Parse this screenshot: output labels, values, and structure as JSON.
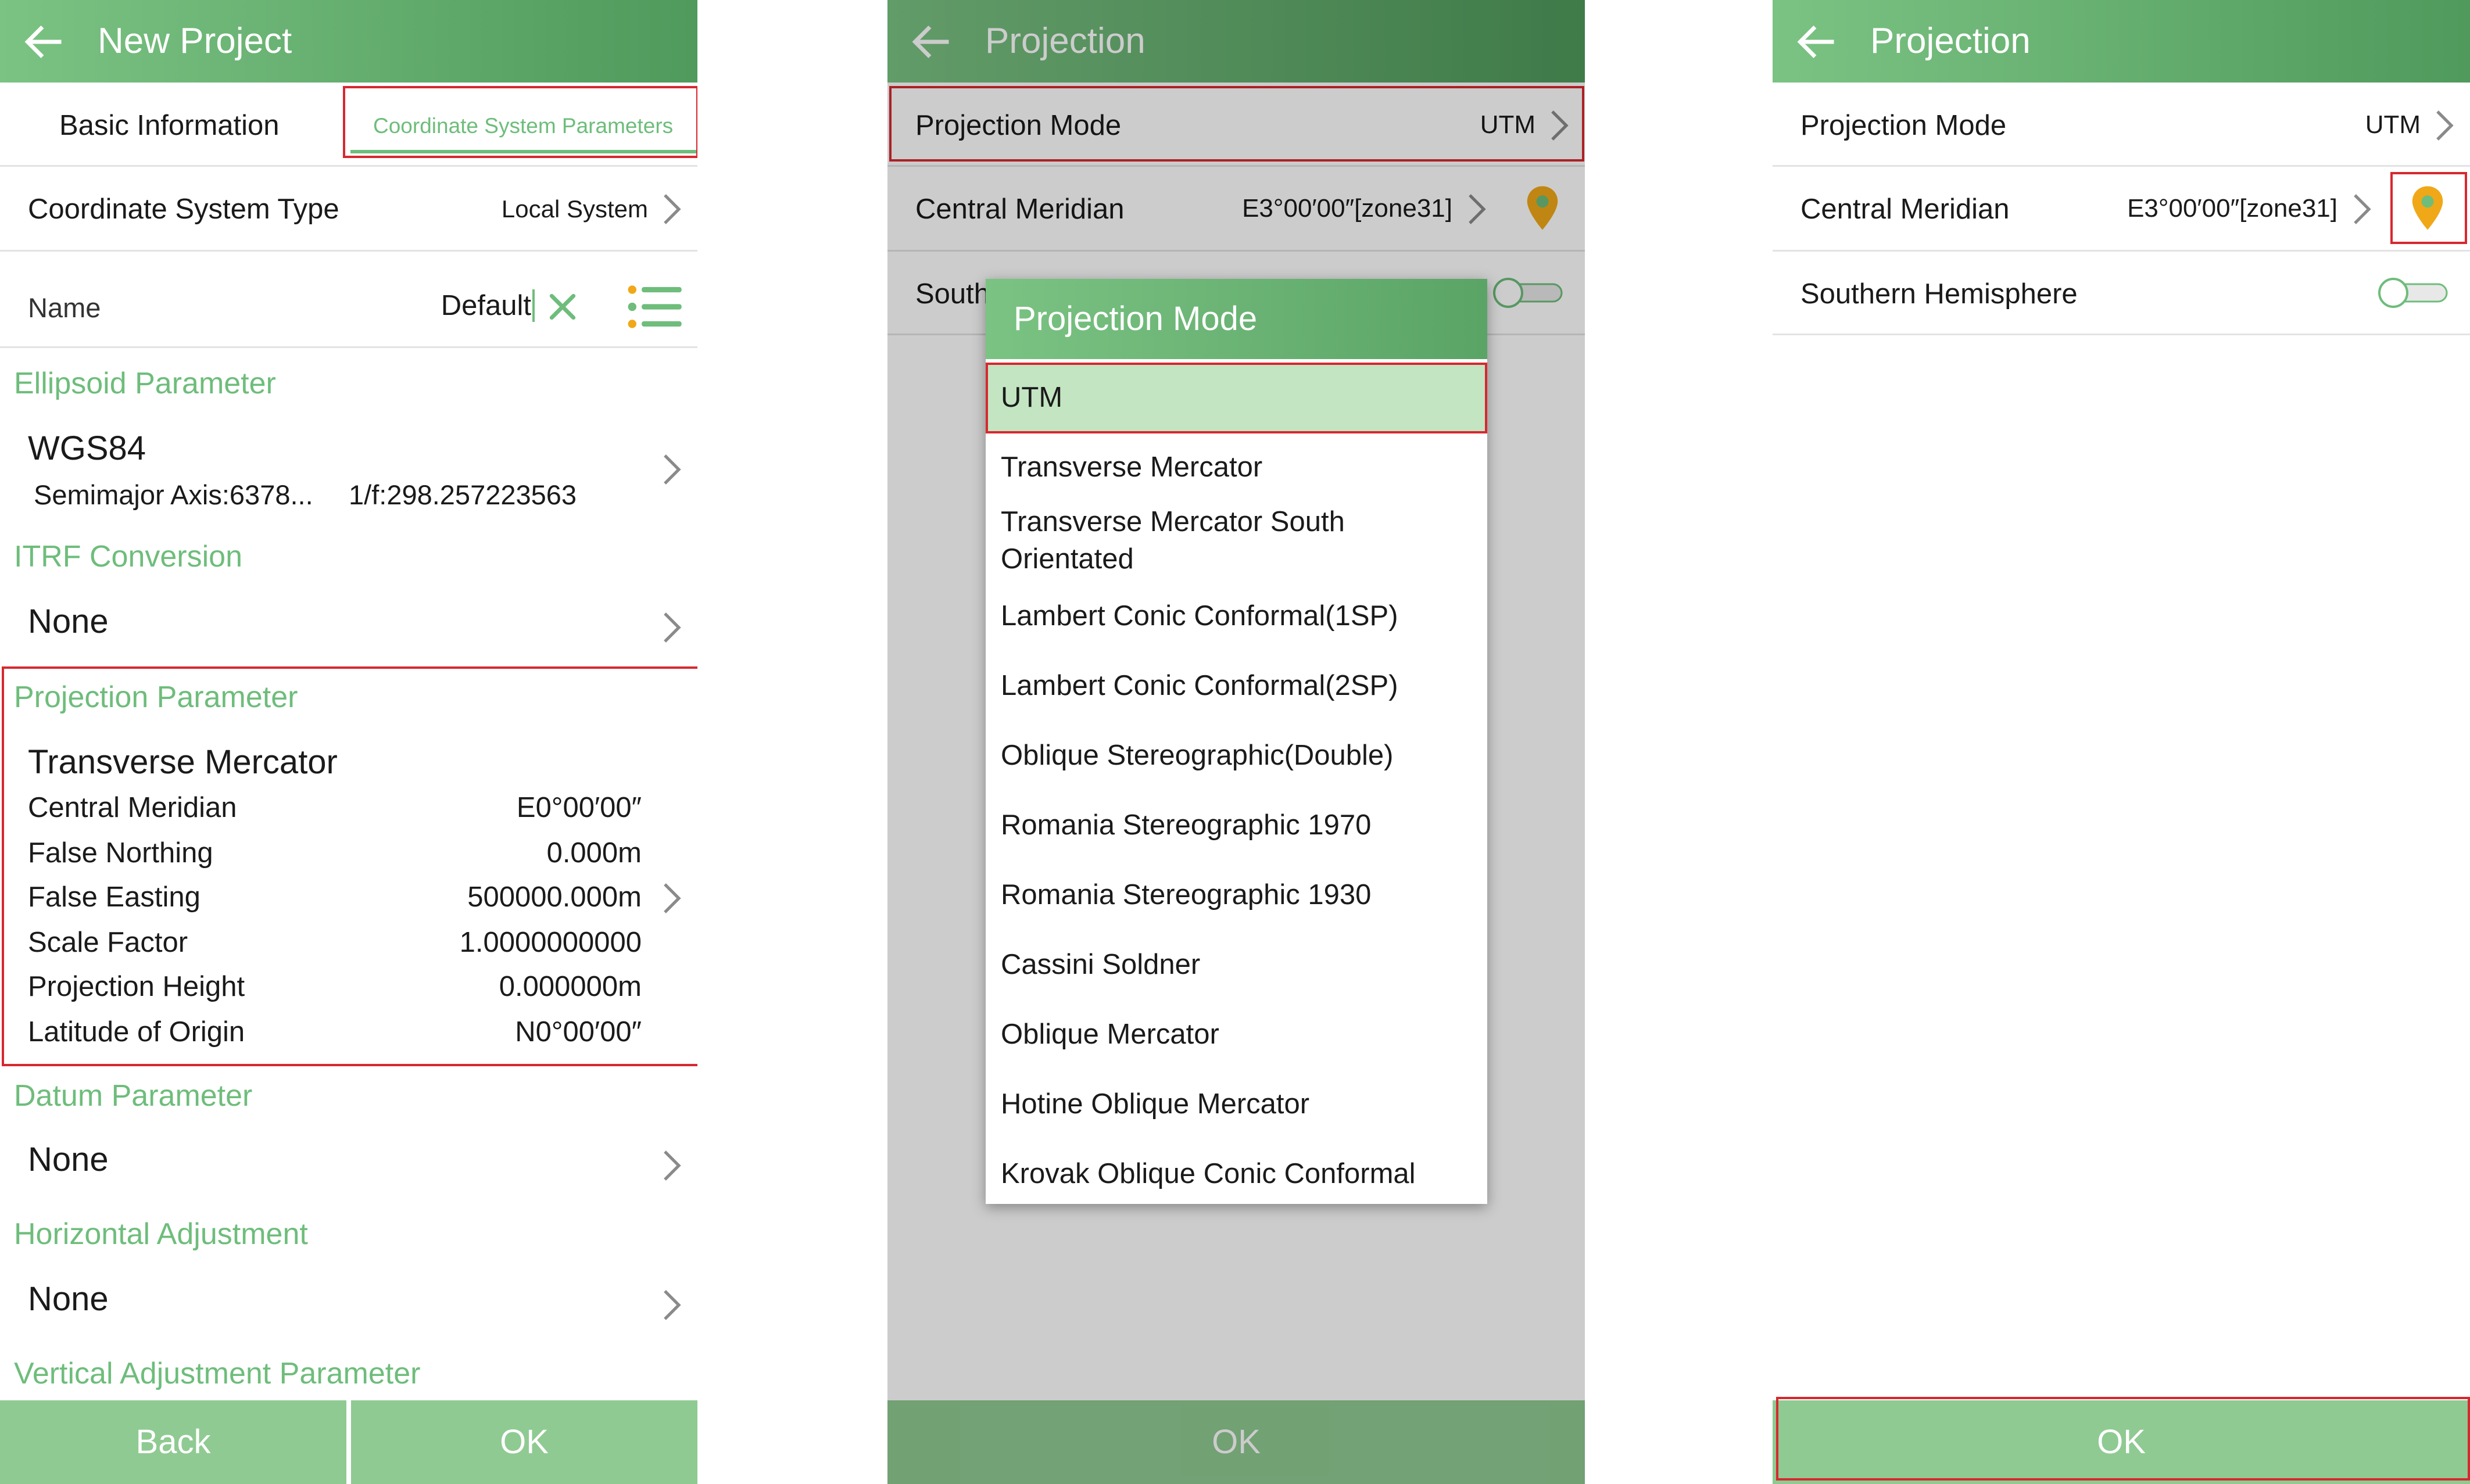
{
  "panel1": {
    "header_title": "New Project",
    "tabs": {
      "basic": "Basic Information",
      "coord": "Coordinate System Parameters"
    },
    "coord_type": {
      "label": "Coordinate System Type",
      "value": "Local System"
    },
    "name": {
      "label": "Name",
      "value": "Default"
    },
    "ellipsoid": {
      "section": "Ellipsoid Parameter",
      "title": "WGS84",
      "axis": "Semimajor Axis:6378...",
      "flattening": "1/f:298.257223563"
    },
    "itrf": {
      "section": "ITRF Conversion",
      "value": "None"
    },
    "projection": {
      "section": "Projection Parameter",
      "title": "Transverse Mercator",
      "rows": [
        {
          "label": "Central Meridian",
          "value": "E0°00′00″"
        },
        {
          "label": "False Northing",
          "value": "0.000m"
        },
        {
          "label": "False Easting",
          "value": "500000.000m"
        },
        {
          "label": "Scale Factor",
          "value": "1.0000000000"
        },
        {
          "label": "Projection Height",
          "value": "0.000000m"
        },
        {
          "label": "Latitude of Origin",
          "value": "N0°00′00″"
        }
      ]
    },
    "datum": {
      "section": "Datum Parameter",
      "value": "None"
    },
    "horizontal": {
      "section": "Horizontal Adjustment",
      "value": "None"
    },
    "vertical": {
      "section": "Vertical Adjustment Parameter"
    },
    "buttons": {
      "back": "Back",
      "ok": "OK"
    }
  },
  "panel2": {
    "header_title": "Projection",
    "mode": {
      "label": "Projection Mode",
      "value": "UTM"
    },
    "meridian": {
      "label": "Central Meridian",
      "value": "E3°00′00″[zone31]"
    },
    "south_partial": "South",
    "dialog": {
      "title": "Projection Mode",
      "options": [
        "UTM",
        "Transverse Mercator",
        "Transverse Mercator South Orientated",
        "Lambert Conic Conformal(1SP)",
        "Lambert Conic Conformal(2SP)",
        "Oblique Stereographic(Double)",
        "Romania Stereographic 1970",
        "Romania Stereographic 1930",
        "Cassini Soldner",
        "Oblique Mercator",
        "Hotine Oblique Mercator",
        "Krovak Oblique Conic Conformal"
      ]
    },
    "ok": "OK"
  },
  "panel3": {
    "header_title": "Projection",
    "mode": {
      "label": "Projection Mode",
      "value": "UTM"
    },
    "meridian": {
      "label": "Central Meridian",
      "value": "E3°00′00″[zone31]"
    },
    "southern": {
      "label": "Southern Hemisphere",
      "state": "off"
    },
    "ok": "OK"
  },
  "colors": {
    "header": "#6cb878",
    "accent": "#6ebd7b",
    "button": "#8fca92",
    "highlight_box": "#d7282f",
    "marker": "#f0a818"
  }
}
